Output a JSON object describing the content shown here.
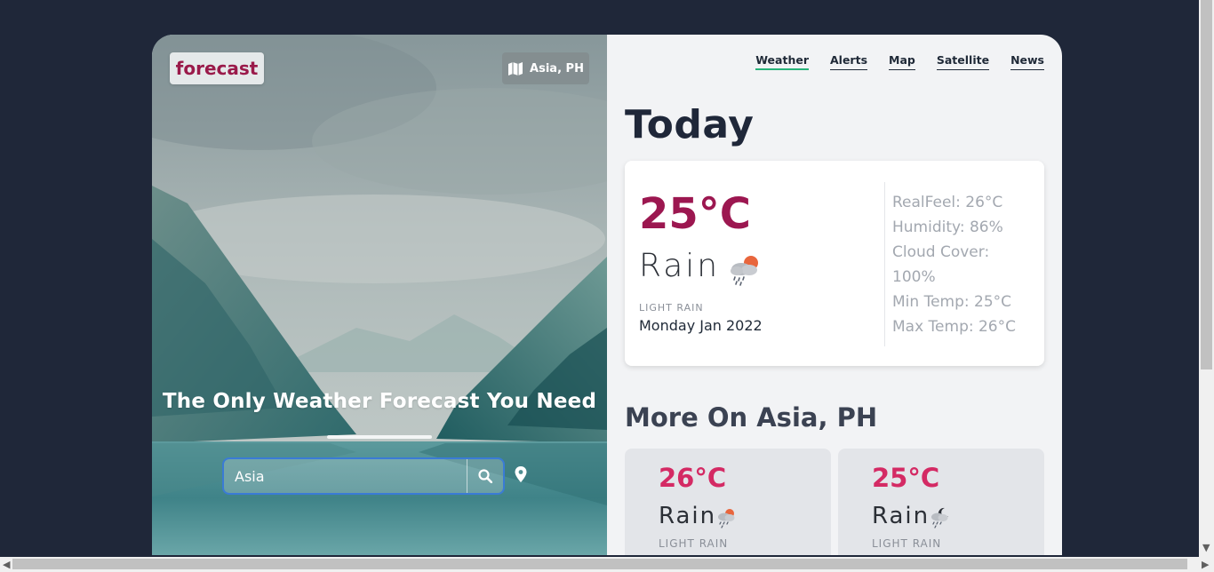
{
  "brand": {
    "logo_text": "forecast",
    "location_badge": "Asia, PH"
  },
  "hero": {
    "tagline": "The Only Weather Forecast You Need",
    "search_value": "Asia"
  },
  "nav": {
    "items": [
      {
        "label": "Weather",
        "active": true
      },
      {
        "label": "Alerts"
      },
      {
        "label": "Map"
      },
      {
        "label": "Satellite"
      },
      {
        "label": "News"
      }
    ]
  },
  "today": {
    "title": "Today",
    "temperature": "25°C",
    "condition": "Rain",
    "description": "LIGHT RAIN",
    "date": "Monday Jan 2022",
    "icon": "rain-cloud-sun-icon",
    "stats": {
      "realfeel": "RealFeel: 26°C",
      "humidity": "Humidity: 86%",
      "cloud_cover": "Cloud Cover: 100%",
      "min_temp": "Min Temp: 25°C",
      "max_temp": "Max Temp: 26°C"
    }
  },
  "more": {
    "title": "More On Asia, PH",
    "cards": [
      {
        "temperature": "26°C",
        "condition": "Rain",
        "description": "LIGHT RAIN",
        "icon": "rain-cloud-sun-icon"
      },
      {
        "temperature": "25°C",
        "condition": "Rain",
        "description": "LIGHT RAIN",
        "icon": "rain-cloud-moon-icon"
      }
    ]
  },
  "colors": {
    "page_bg": "#1f2739",
    "temp_accent": "#9c1750",
    "mini_temp": "#d42a64",
    "active_tab": "#28b37a",
    "search_border": "#3a7bd5"
  }
}
